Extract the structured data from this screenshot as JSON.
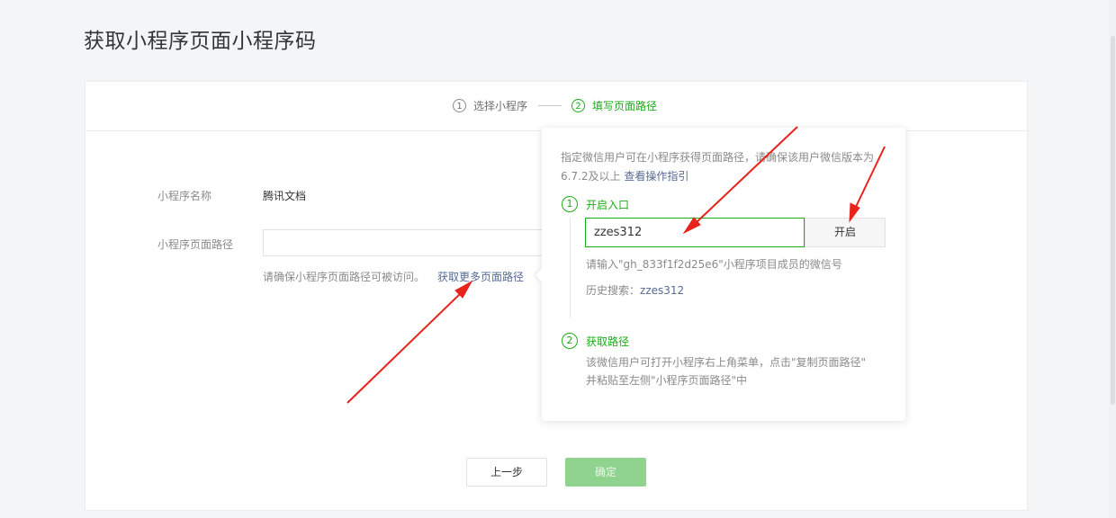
{
  "page": {
    "title": "获取小程序页面小程序码"
  },
  "steps": [
    {
      "num": "1",
      "label": "选择小程序"
    },
    {
      "num": "2",
      "label": "填写页面路径"
    }
  ],
  "form": {
    "name_label": "小程序名称",
    "name_value": "腾讯文档",
    "path_label": "小程序页面路径",
    "path_value": "",
    "hint": "请确保小程序页面路径可被访问。",
    "hint_link": "获取更多页面路径"
  },
  "popover": {
    "desc": "指定微信用户可在小程序获得页面路径，请确保该用户微信版本为6.7.2及以上",
    "desc_link": "查看操作指引",
    "step1": {
      "num": "1",
      "title": "开启入口"
    },
    "wechat_input": "zzes312",
    "open_button": "开启",
    "input_hint": "请输入\"gh_833f1f2d25e6\"小程序项目成员的微信号",
    "history_label": "历史搜索：",
    "history_value": "zzes312",
    "step2": {
      "num": "2",
      "title": "获取路径"
    },
    "step2_desc_1": "该微信用户可打开小程序右上角菜单，点击\"复制页面路径\"",
    "step2_desc_2": "并粘贴至左侧\"小程序页面路径\"中"
  },
  "buttons": {
    "prev": "上一步",
    "confirm": "确定"
  },
  "colors": {
    "accent": "#1aad19",
    "link": "#576b95",
    "annotation": "#e8231c"
  }
}
